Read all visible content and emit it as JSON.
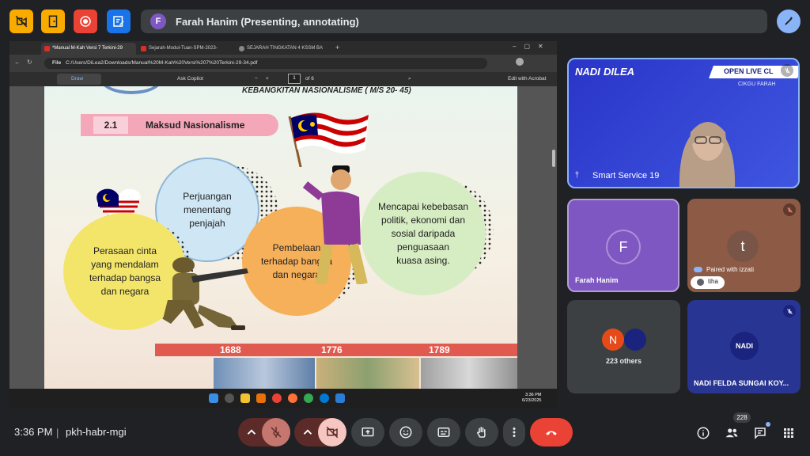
{
  "top_bar": {
    "icons": [
      "no-video-icon",
      "door-icon",
      "record-icon",
      "edit-note-icon"
    ],
    "presenter_initial": "F",
    "presenter_text": "Farah Hanim (Presenting, annotating)"
  },
  "browser": {
    "tabs": [
      "*Manual M-Kah Versi 7 Terkini-29",
      "Sejarah-Modul-Tuan-SPM-2023-",
      "SEJARAH TINGKATAN 4 KSSM BA"
    ],
    "address_prefix": "File",
    "address": "C:/Users/DiLea2/Downloads/Manual%20M-Kah%20Versi%207%20Terkini-29-34.pdf",
    "pdf_toolbar": {
      "draw_label": "Draw",
      "ask_copilot": "Ask Copilot",
      "page_current": "1",
      "page_of": "of 6",
      "edit_acrobat": "Edit with Acrobat"
    }
  },
  "slide": {
    "heading": "KEBANGKITAN NASIONALISME ( M/S 20- 45)",
    "section_number": "2.1",
    "section_title": "Maksud Nasionalisme",
    "bubbles": [
      {
        "text": "Perasaan cinta\nyang mendalam\nterhadap bangsa\ndan negara",
        "color": "#f3e56a"
      },
      {
        "text": "Perjuangan\nmenentang\npenjajah",
        "color": "#cfe6f5"
      },
      {
        "text": "Pembelaan\nterhadap bangsa\ndan negara",
        "color": "#f6b05a"
      },
      {
        "text": "Mencapai kebebasan\npolitik, ekonomi dan\nsosial daripada\npenguasaan\nkuasa asing.",
        "color": "#d6ecc2"
      }
    ],
    "years": [
      "1688",
      "1776",
      "1789"
    ]
  },
  "taskbar": {
    "time": "3:36 PM",
    "date": "6/23/2025"
  },
  "participants": {
    "main_tile": {
      "logo_left": "NADI",
      "logo_right": "DILEA",
      "banner": "OPEN LIVE CL",
      "sub_banner": "CIKGU FARAH",
      "name": "Smart Service 19"
    },
    "farah": {
      "initial": "F",
      "name": "Farah Hanim"
    },
    "paired": {
      "initial": "t",
      "paired_text": "Paired with izzati",
      "chip": "tiha"
    },
    "others": {
      "initial": "N",
      "label": "223 others"
    },
    "nadi": {
      "logo": "NADI",
      "name": "NADI FELDA SUNGAI KOY..."
    }
  },
  "bottom_bar": {
    "time": "3:36 PM",
    "separator": "|",
    "meeting_code": "pkh-habr-mgi",
    "people_count": "228"
  },
  "colors": {
    "background": "#202124",
    "end_call": "#ea4335",
    "muted_control": "#8c2f2f",
    "accent": "#8ab4f8"
  }
}
